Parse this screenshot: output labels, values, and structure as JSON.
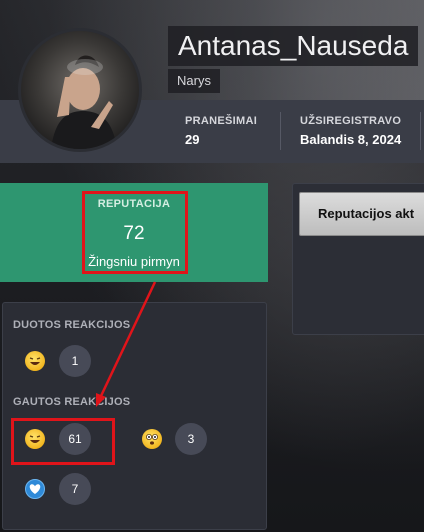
{
  "profile": {
    "username": "Antanas_Nauseda",
    "user_title": "Narys",
    "avatar_icon": "user-avatar-photo"
  },
  "stats": [
    {
      "label": "PRANEŠIMAI",
      "value": "29"
    },
    {
      "label": "UŽSIREGISTRAVO",
      "value": "Balandis 8, 2024"
    }
  ],
  "reputation": {
    "label": "REPUTACIJA",
    "value": "72",
    "status": "Žingsniu pirmyn",
    "color": "#2e9670"
  },
  "reactions": {
    "given_title": "DUOTOS REAKCIJOS",
    "given": [
      {
        "icon": "laugh-emoji-icon",
        "count": "1"
      }
    ],
    "received_title": "GAUTOS REAKCIJOS",
    "received": [
      {
        "icon": "laugh-emoji-icon",
        "count": "61"
      },
      {
        "icon": "shocked-emoji-icon",
        "count": "3"
      },
      {
        "icon": "heart-reaction-icon",
        "count": "7"
      }
    ]
  },
  "right_panel": {
    "tab_label": "Reputacijos akt"
  },
  "annotation_color": "#e0141a"
}
